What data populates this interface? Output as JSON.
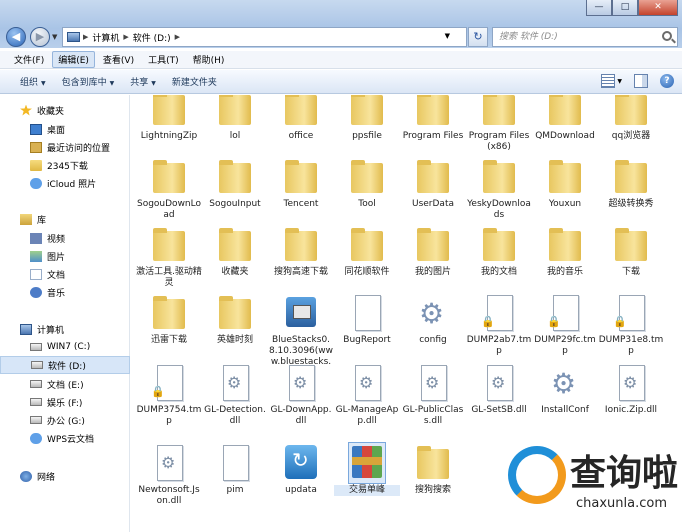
{
  "window": {
    "minimize": "—",
    "maximize": "□",
    "close": "✕"
  },
  "address": {
    "segments": [
      "计算机",
      "软件 (D:)"
    ],
    "search_placeholder": "搜索 软件 (D:)"
  },
  "menu": [
    "文件(F)",
    "编辑(E)",
    "查看(V)",
    "工具(T)",
    "帮助(H)"
  ],
  "toolbar": {
    "organize": "组织",
    "include_library": "包含到库中",
    "share": "共享",
    "new_folder": "新建文件夹"
  },
  "sidebar": {
    "favorites_header": "收藏夹",
    "favorites": [
      "桌面",
      "最近访问的位置",
      "2345下载",
      "iCloud 照片"
    ],
    "libraries_header": "库",
    "libraries": [
      "视频",
      "图片",
      "文档",
      "音乐"
    ],
    "computer_header": "计算机",
    "drives": [
      "WIN7 (C:)",
      "软件 (D:)",
      "文档 (E:)",
      "娱乐 (F:)",
      "办公 (G:)",
      "WPS云文档"
    ],
    "network_header": "网络",
    "selected_drive": "软件 (D:)"
  },
  "files": [
    {
      "name": "LightningZip",
      "kind": "folder"
    },
    {
      "name": "lol",
      "kind": "folder"
    },
    {
      "name": "office",
      "kind": "folder"
    },
    {
      "name": "ppsfile",
      "kind": "folder"
    },
    {
      "name": "Program Files",
      "kind": "folder"
    },
    {
      "name": "Program Files (x86)",
      "kind": "folder"
    },
    {
      "name": "QMDownload",
      "kind": "folder"
    },
    {
      "name": "qq浏览器",
      "kind": "folder"
    },
    {
      "name": "SogouDownLoad",
      "kind": "folder"
    },
    {
      "name": "SogouInput",
      "kind": "folder"
    },
    {
      "name": "Tencent",
      "kind": "folder"
    },
    {
      "name": "Tool",
      "kind": "folder"
    },
    {
      "name": "UserData",
      "kind": "folder"
    },
    {
      "name": "YeskyDownloads",
      "kind": "folder"
    },
    {
      "name": "Youxun",
      "kind": "folder"
    },
    {
      "name": "超级转换秀",
      "kind": "folder"
    },
    {
      "name": "激活工具.驱动精灵",
      "kind": "folder"
    },
    {
      "name": "收藏夹",
      "kind": "folder"
    },
    {
      "name": "搜狗高速下载",
      "kind": "folder"
    },
    {
      "name": "同花顺软件",
      "kind": "folder"
    },
    {
      "name": "我的图片",
      "kind": "folder"
    },
    {
      "name": "我的文档",
      "kind": "folder"
    },
    {
      "name": "我的音乐",
      "kind": "folder"
    },
    {
      "name": "下载",
      "kind": "folder"
    },
    {
      "name": "迅雷下载",
      "kind": "folder"
    },
    {
      "name": "英雄时刻",
      "kind": "folder"
    },
    {
      "name": "BlueStacks0.8.10.3096(www.bluestacks.n...",
      "kind": "msi"
    },
    {
      "name": "BugReport",
      "kind": "file"
    },
    {
      "name": "config",
      "kind": "config"
    },
    {
      "name": "DUMP2ab7.tmp",
      "kind": "tmp"
    },
    {
      "name": "DUMP29fc.tmp",
      "kind": "tmp"
    },
    {
      "name": "DUMP31e8.tmp",
      "kind": "tmp"
    },
    {
      "name": "DUMP3754.tmp",
      "kind": "tmp"
    },
    {
      "name": "GL-Detection.dll",
      "kind": "dll"
    },
    {
      "name": "GL-DownApp.dll",
      "kind": "dll"
    },
    {
      "name": "GL-ManageApp.dll",
      "kind": "dll"
    },
    {
      "name": "GL-PublicClass.dll",
      "kind": "dll"
    },
    {
      "name": "GL-SetSB.dll",
      "kind": "dll"
    },
    {
      "name": "InstallConf",
      "kind": "config"
    },
    {
      "name": "Ionic.Zip.dll",
      "kind": "dll"
    },
    {
      "name": "Newtonsoft.Json.dll",
      "kind": "dll"
    },
    {
      "name": "pim",
      "kind": "file"
    },
    {
      "name": "updata",
      "kind": "update"
    },
    {
      "name": "交易单峰",
      "kind": "rar"
    },
    {
      "name": "搜狗搜索",
      "kind": "folder"
    }
  ],
  "selected_file": "交易单峰",
  "watermark": {
    "brand": "查询啦",
    "site": "chaxunla.com"
  }
}
